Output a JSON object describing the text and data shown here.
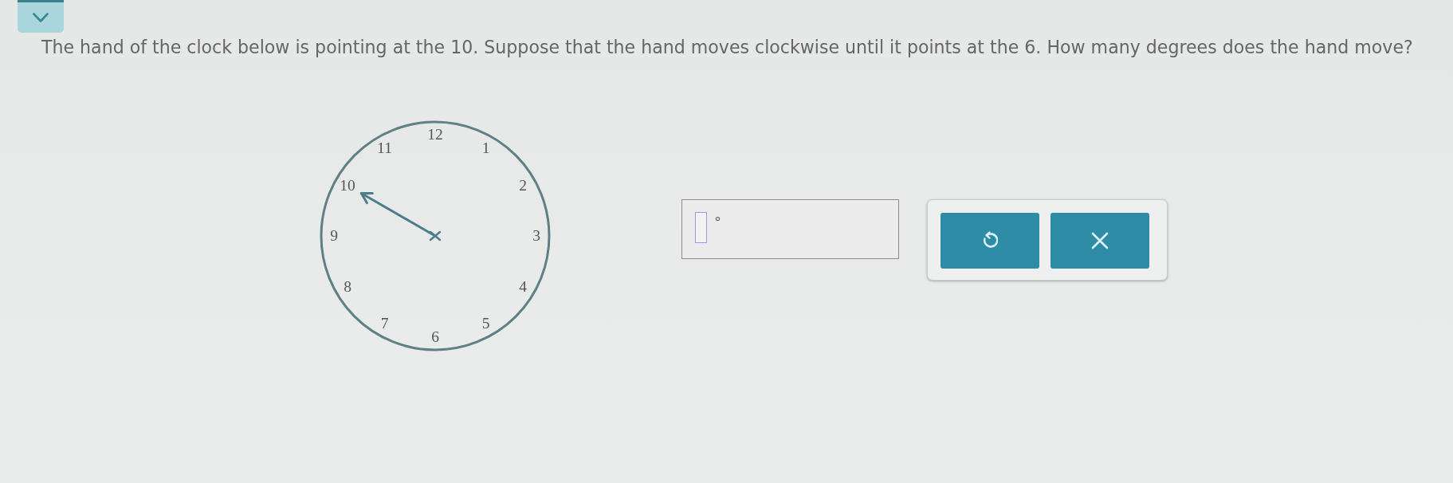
{
  "question": {
    "text": "The hand of the clock below is pointing at the 10. Suppose that the hand moves clockwise until it points at the 6. How many degrees does the hand move?"
  },
  "clock": {
    "numbers": [
      {
        "label": "12",
        "hand_points_here": false
      },
      {
        "label": "1",
        "hand_points_here": false
      },
      {
        "label": "2",
        "hand_points_here": false
      },
      {
        "label": "3",
        "hand_points_here": false
      },
      {
        "label": "4",
        "hand_points_here": false
      },
      {
        "label": "5",
        "hand_points_here": false
      },
      {
        "label": "6",
        "hand_points_here": false
      },
      {
        "label": "7",
        "hand_points_here": false
      },
      {
        "label": "8",
        "hand_points_here": false
      },
      {
        "label": "9",
        "hand_points_here": false
      },
      {
        "label": "10",
        "hand_points_here": true
      },
      {
        "label": "11",
        "hand_points_here": false
      }
    ]
  },
  "answer": {
    "unit": "°"
  },
  "tools": [
    {
      "kind": "undo"
    },
    {
      "kind": "clear"
    }
  ]
}
